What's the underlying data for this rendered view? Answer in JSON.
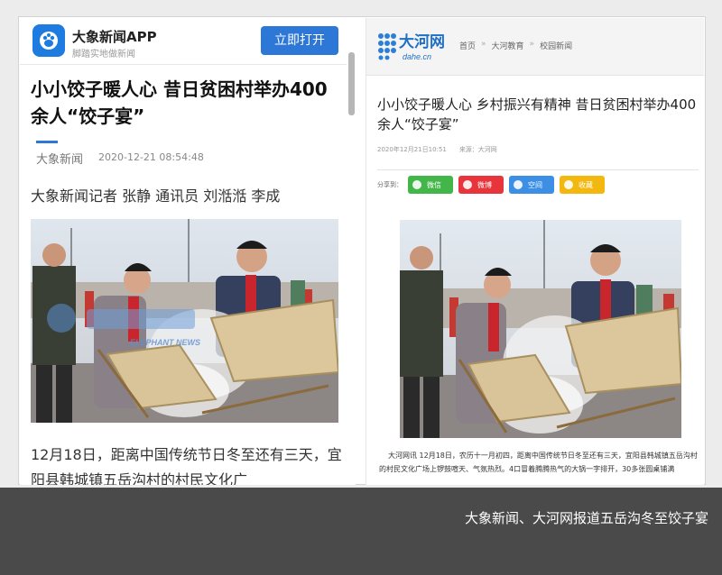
{
  "left_panel": {
    "app_name": "大象新闻APP",
    "app_slogan": "脚踏实地做新闻",
    "open_button": "立即打开",
    "title": "小小饺子暖人心 昔日贫困村举办400余人“饺子宴”",
    "source": "大象新闻",
    "timestamp": "2020-12-21 08:54:48",
    "reporter": "大象新闻记者 张静 通讯员 刘湉湉 李成",
    "body": "12月18日，距离中国传统节日冬至还有三天，宜阳县韩城镇五岳沟村的村民文化广",
    "watermark": "ELEPHANT NEWS"
  },
  "right_panel": {
    "site_name": "大河网",
    "site_domain": "dahe.cn",
    "breadcrumb": [
      "首页",
      "大河教育",
      "校园新闻"
    ],
    "breadcrumb_sep": "»",
    "title": "小小饺子暖人心 乡村振兴有精神 昔日贫困村举办400余人“饺子宴”",
    "date": "2020年12月21日10:51",
    "source": "来源：大河网",
    "share_label": "分享到：",
    "share_buttons": [
      {
        "label": "微信",
        "color": "#43b649"
      },
      {
        "label": "微博",
        "color": "#e8343b"
      },
      {
        "label": "空间",
        "color": "#3c8fe4"
      },
      {
        "label": "收藏",
        "color": "#f3b80f"
      }
    ],
    "body": "大河网讯 12月18日，农历十一月初四，距离中国传统节日冬至还有三天，宜阳县韩城镇五岳沟村的村民文化广场上锣鼓喧天、气氛热烈。4口冒着腾腾热气的大锅一字排开，30多张圆桌铺满"
  },
  "caption": "大象新闻、大河网报道五岳沟冬至饺子宴",
  "colors": {
    "brand_blue": "#2d77d7",
    "caption_bg": "#4a4a4a"
  }
}
